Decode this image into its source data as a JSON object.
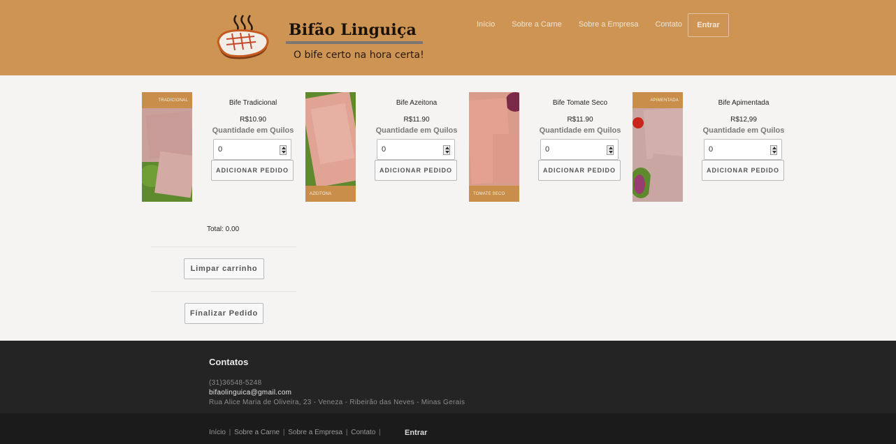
{
  "header": {
    "brand_title": "Bifão Linguiça",
    "tagline": "O bife certo na hora certa!",
    "nav": [
      "Início",
      "Sobre a Carne",
      "Sobre a Empresa",
      "Contato"
    ],
    "login_label": "Entrar",
    "background_color": "#cd9454"
  },
  "products": [
    {
      "name": "Bife Tradicional",
      "price": "R$10.90",
      "qty_label": "Quantidade em Quilos",
      "qty_value": "0",
      "add_label": "ADICIONAR PEDIDO",
      "band_label": "TRADICIONAL"
    },
    {
      "name": "Bife Azeitona",
      "price": "R$11.90",
      "qty_label": "Quantidade em Quilos",
      "qty_value": "0",
      "add_label": "ADICIONAR PEDIDO",
      "band_label": "AZEITONA"
    },
    {
      "name": "Bife Tomate Seco",
      "price": "R$11.90",
      "qty_label": "Quantidade em Quilos",
      "qty_value": "0",
      "add_label": "ADICIONAR PEDIDO",
      "band_label": "TOMATE SECO"
    },
    {
      "name": "Bife Apimentada",
      "price": "R$12,99",
      "qty_label": "Quantidade em Quilos",
      "qty_value": "0",
      "add_label": "ADICIONAR PEDIDO",
      "band_label": "APIMENTADA"
    }
  ],
  "cart": {
    "total": "Total: 0.00",
    "clear_label": "Limpar carrinho",
    "checkout_label": "Finalizar Pedido"
  },
  "footer": {
    "heading": "Contatos",
    "phone": "(31)36548-5248",
    "email": "bifaolinguica@gmail.com",
    "address": "Rua Alice Maria de Oliveira, 23 - Veneza - Ribeirão das Neves - Minas Gerais",
    "links": [
      "Início",
      "Sobre a Carne",
      "Sobre a Empresa",
      "Contato"
    ],
    "login_label": "Entrar"
  }
}
